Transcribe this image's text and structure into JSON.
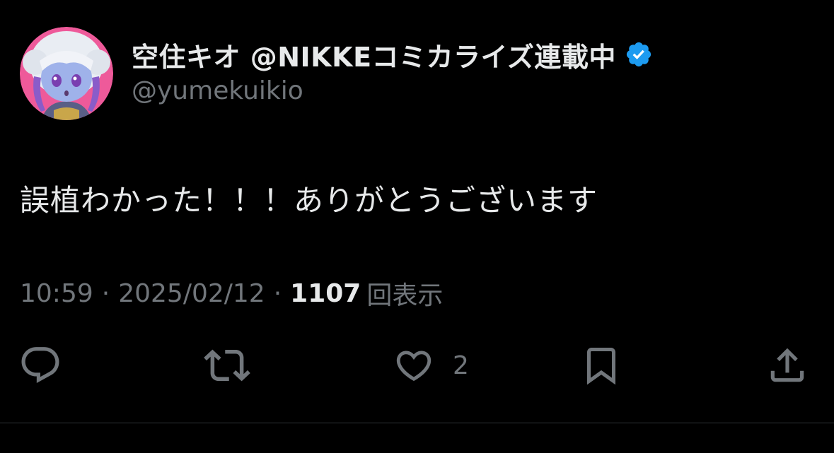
{
  "author": {
    "display_name": "空住キオ @NIKKEコミカライズ連載中",
    "handle": "@yumekuikio",
    "verified": true,
    "verified_color": "#1d9bf0"
  },
  "tweet": {
    "text": "誤植わかった！！！ありがとうございます",
    "time": "10:59",
    "separator": "·",
    "date": "2025/02/12",
    "views_count": "1107",
    "views_label": "回表示"
  },
  "actions": {
    "reply_icon": "reply-icon",
    "retweet_icon": "retweet-icon",
    "like_icon": "heart-icon",
    "like_count": "2",
    "bookmark_icon": "bookmark-icon",
    "share_icon": "share-icon"
  },
  "colors": {
    "background": "#000000",
    "primary_text": "#e7e9ea",
    "secondary_text": "#71767b"
  }
}
